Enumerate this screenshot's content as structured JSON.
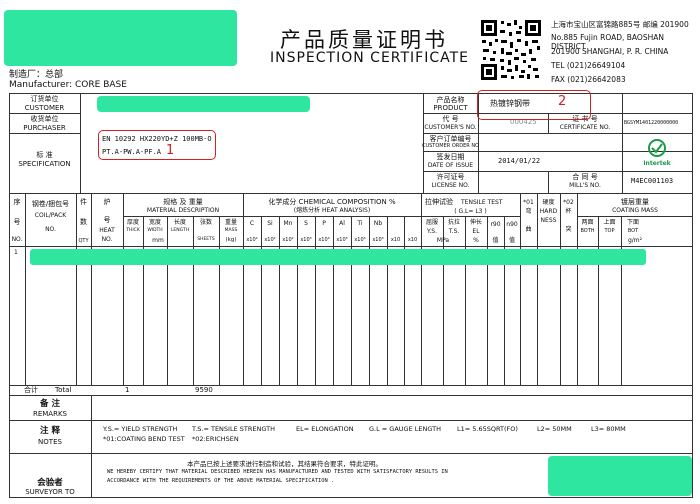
{
  "header": {
    "title_cn": "产品质量证明书",
    "title_en": "INSPECTION  CERTIFICATE",
    "maker_cn": "制造厂：总部",
    "maker_en": "Manufacturer: CORE BASE",
    "addr_cn": "上海市宝山区富锦路885号 邮编 201900",
    "addr_en1": "No.885 Fujin ROAD, BAOSHAN DISTRICT",
    "addr_en2": "201900 SHANGHAI, P. R. CHINA",
    "tel": "TEL (021)26649104",
    "fax": "FAX (021)26642083"
  },
  "info": {
    "orderer_cn": "订货单位",
    "orderer_en": "CUSTOMER",
    "receiver_cn": "收货单位",
    "receiver_en": "PURCHASER",
    "standard_cn": "标  准",
    "standard_en": "SPECIFICATION",
    "standard_line1": "EN 10292 HX220YD+Z 100MB-O",
    "standard_line2": "PT.A-PW.A-PF.A",
    "product_cn": "产品名称",
    "product_en": "PRODUCT",
    "product_value": "热镀锌钢带",
    "code_cn": "代    号",
    "code_en": "CUSTOMER'S NO.",
    "code_value": "000425",
    "cert_cn": "证 书 号",
    "cert_en": "CERTIFICATE NO.",
    "cert_value": "BGSYM1401220000000",
    "custorder_cn": "客户订单编号",
    "custorder_en": "CUSTOMER ORDER NO",
    "issue_cn": "签发日期",
    "issue_en": "DATE OF ISSUE",
    "issue_value": "2014/01/22",
    "license_cn": "许可证号",
    "license_en": "LICENSE NO.",
    "contract_cn": "合 同 号",
    "contract_en": "MILL'S NO.",
    "contract_value": "M4EC001103",
    "intertek": "Intertek"
  },
  "table": {
    "seq_cn": "序",
    "seq_no": "号",
    "seq_en": "NO.",
    "coil_cn": "钢卷/捆包号",
    "coil_en1": "COIL/PACK",
    "coil_en2": "NO.",
    "qty_cn1": "件",
    "qty_cn2": "数",
    "qty_en": "QTY",
    "heat_cn1": "炉",
    "heat_cn2": "号",
    "heat_en1": "HEAT",
    "heat_en2": "NO.",
    "mat_cn": "规格 及 重量",
    "mat_en": "MATERIAL DESCRIPTION",
    "thick": "厚度",
    "thick_en": "THICK",
    "width": "宽度",
    "width_en": "WIDTH",
    "length": "长度",
    "length_en": "LENGTH",
    "sheets": "张数",
    "sheets_en": "SHEETS",
    "mass": "重量",
    "mass_en": "MASS",
    "mm": "mm",
    "kg": "(kg)",
    "chem_cn": "化学成分 CHEMICAL COMPOSITION %",
    "chem_sub": "(熔炼分析 HEAT ANALYSIS)",
    "elements": [
      "C",
      "Si",
      "Mn",
      "S",
      "P",
      "Al",
      "Ti",
      "Nb",
      "",
      ""
    ],
    "units": [
      "x10²",
      "x10²",
      "x10²",
      "x10³",
      "x10³",
      "x10³",
      "x10³",
      "x10³",
      "x10",
      "x10"
    ],
    "tensile_cn": "拉伸试验",
    "tensile_en": "TENSILE TEST",
    "gl": "( G.L= L3 )",
    "ys": "屈服",
    "ys_en": "Y.S.",
    "ts": "抗拉",
    "ts_en": "T.S.",
    "el": "伸长",
    "el_en": "EL",
    "mpa": "MPa",
    "pct": "%",
    "r90": "r90",
    "n90": "n90",
    "zhi": "值",
    "c01": "*01",
    "c01b": "弯",
    "c01c": "曲",
    "hard_cn": "硬度",
    "hard_en1": "HARD",
    "hard_en2": "NESS",
    "c02": "*02",
    "c02b": "杯",
    "c02c": "突",
    "coat_cn": "镀层重量",
    "coat_en": "COATING MASS",
    "both": "两面",
    "both_en": "BOTH",
    "top": "上面",
    "top_en": "TOP",
    "bot": "下面",
    "bot_en": "BOT",
    "gm2": "g/m²",
    "row1_no": "1",
    "total_cn": "合计",
    "total_en": "Total",
    "total_qty": "1",
    "total_mass": "9590"
  },
  "remarks": {
    "cn": "备  注",
    "en": "REMARKS"
  },
  "notes": {
    "cn": "注  释",
    "en": "NOTES",
    "ys": "Y.S.= YIELD STRENGTH",
    "ts": "T.S.= TENSILE STRENGTH",
    "el": "EL= ELONGATION",
    "gl": "G.L = GAUGE LENGTH",
    "l1": "L1= 5.65SQRT(FO)",
    "l2": "L2= 50MM",
    "l3": "L3= 80MM",
    "c01": "*01:COATING BEND TEST",
    "c02": "*02:ERICHSEN"
  },
  "certify": {
    "cn_label": "会验者",
    "en_label": "SURVEYOR TO",
    "cn_text": "本产品已按上述要求进行制造和试验，其结果符合要求，特此证明。",
    "en_line1": "WE HEREBY CERTIFY THAT MATERIAL DESCRIBED HEREIN HAS MANUFACTURED AND TESTED WITH SATISFACTORY RESULTS IN",
    "en_line2": "ACCORDANCE WITH THE REQUIREMENTS OF THE ABOVE MATERIAL SPECIFICATION ."
  },
  "annotations": {
    "a1": "1",
    "a2": "2"
  },
  "colors": {
    "redact": "#2ee6a0",
    "annotation": "#d42020",
    "intertek": "#1c9a4a"
  }
}
